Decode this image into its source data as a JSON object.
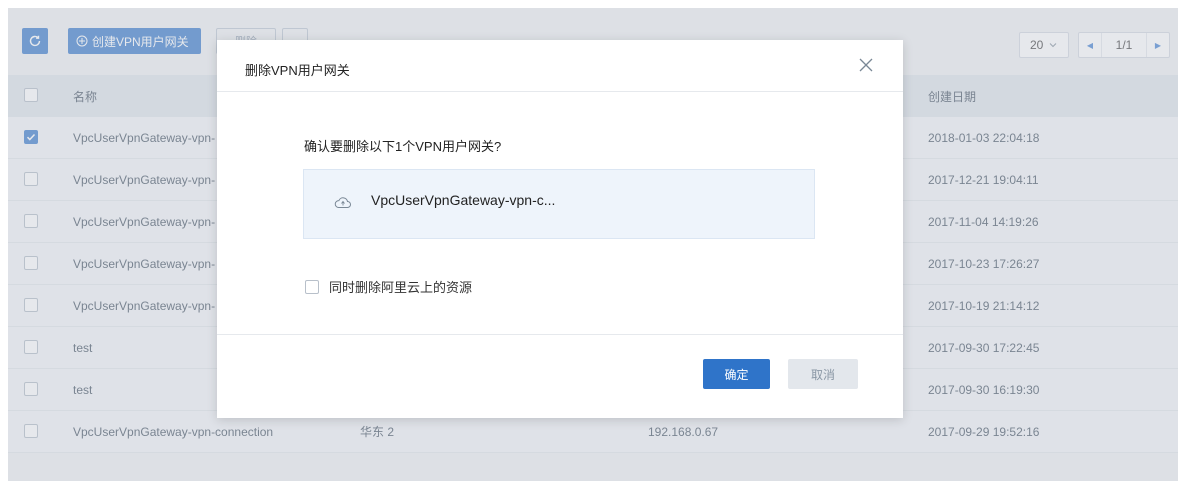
{
  "toolbar": {
    "create_label": "创建VPN用户网关",
    "ghost_label": "删除",
    "page_size": "20",
    "page_indicator": "1/1"
  },
  "table": {
    "headers": {
      "name": "名称",
      "date": "创建日期"
    },
    "rows": [
      {
        "name": "VpcUserVpnGateway-vpn-",
        "region": "",
        "ip": "",
        "date": "2018-01-03 22:04:18",
        "checked": true
      },
      {
        "name": "VpcUserVpnGateway-vpn-",
        "region": "",
        "ip": "",
        "date": "2017-12-21 19:04:11",
        "checked": false
      },
      {
        "name": "VpcUserVpnGateway-vpn-",
        "region": "",
        "ip": "",
        "date": "2017-11-04 14:19:26",
        "checked": false
      },
      {
        "name": "VpcUserVpnGateway-vpn-",
        "region": "",
        "ip": "",
        "date": "2017-10-23 17:26:27",
        "checked": false
      },
      {
        "name": "VpcUserVpnGateway-vpn-",
        "region": "",
        "ip": "",
        "date": "2017-10-19 21:14:12",
        "checked": false
      },
      {
        "name": "test",
        "region": "",
        "ip": "",
        "date": "2017-09-30 17:22:45",
        "checked": false
      },
      {
        "name": "test",
        "region": "",
        "ip": "",
        "date": "2017-09-30 16:19:30",
        "checked": false
      },
      {
        "name": "VpcUserVpnGateway-vpn-connection",
        "region": "华东 2",
        "ip": "192.168.0.67",
        "date": "2017-09-29 19:52:16",
        "checked": false
      }
    ]
  },
  "modal": {
    "title": "删除VPN用户网关",
    "question": "确认要删除以下1个VPN用户网关?",
    "item_name": "VpcUserVpnGateway-vpn-c...",
    "also_delete_label": "同时删除阿里云上的资源",
    "ok_label": "确定",
    "cancel_label": "取消"
  },
  "colors": {
    "primary": "#2f74c9",
    "background": "#eef0f3",
    "header_bg": "#dde3ea"
  },
  "icons": [
    "refresh-icon",
    "add-icon",
    "chevron-down-icon",
    "prev-page-icon",
    "next-page-icon",
    "close-icon",
    "cloud-icon",
    "check-icon"
  ]
}
